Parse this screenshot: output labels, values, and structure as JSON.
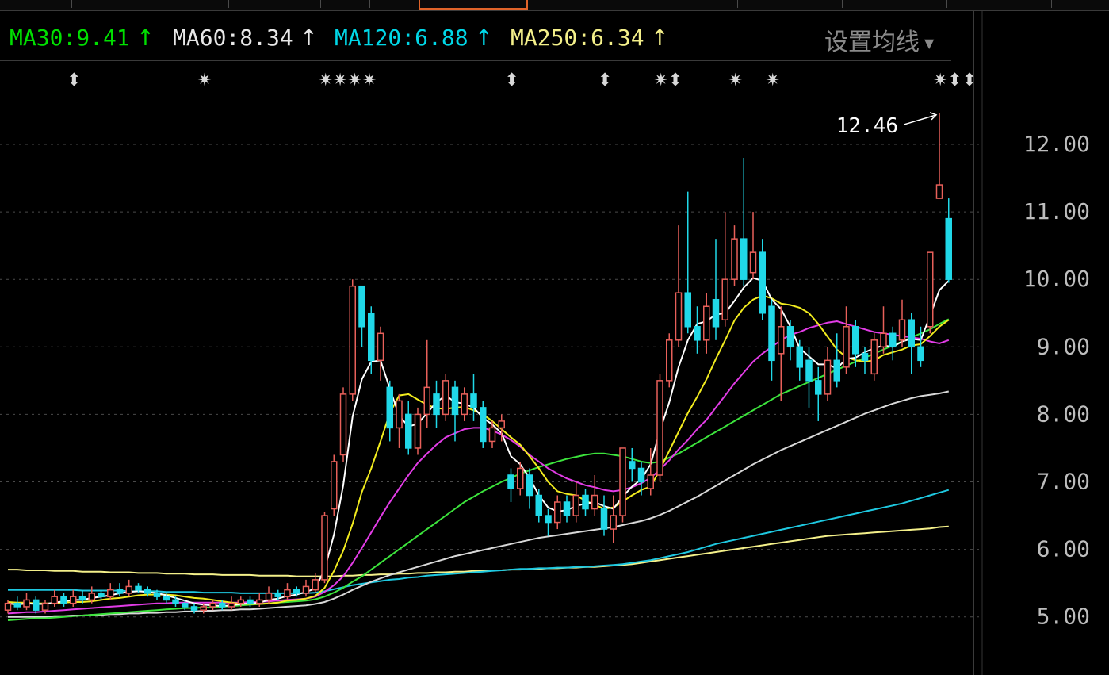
{
  "legend": [
    {
      "label": "MA30:9.41",
      "arrow": "↑",
      "color": "#00e000"
    },
    {
      "label": "MA60:8.34",
      "arrow": "↑",
      "color": "#e8e8e8"
    },
    {
      "label": "MA120:6.88",
      "arrow": "↑",
      "color": "#00d8e8"
    },
    {
      "label": "MA250:6.34",
      "arrow": "↑",
      "color": "#f4f08a"
    }
  ],
  "settings_label": "设置均线",
  "event_markers": [
    {
      "i": 7,
      "glyph": "⬍"
    },
    {
      "i": 21,
      "glyph": "✷"
    },
    {
      "i": 34,
      "glyph": "✷✷✷✷"
    },
    {
      "i": 54,
      "glyph": "⬍"
    },
    {
      "i": 64,
      "glyph": "⬍"
    },
    {
      "i": 70,
      "glyph": "✷⬍"
    },
    {
      "i": 78,
      "glyph": "✷"
    },
    {
      "i": 82,
      "glyph": "✷"
    },
    {
      "i": 100,
      "glyph": "✷⬍⬍"
    }
  ],
  "chart_data": {
    "type": "candlestick",
    "ylim": [
      4.5,
      13.0
    ],
    "yticks": [
      "12.00",
      "11.00",
      "10.00",
      "9.00",
      "8.00",
      "7.00",
      "6.00",
      "5.00"
    ],
    "max_label": "12.46",
    "up_color": "#e8605a",
    "down_color": "#20d8e8",
    "candles": [
      [
        5.1,
        5.2,
        5.25,
        5.05
      ],
      [
        5.2,
        5.15,
        5.3,
        5.1
      ],
      [
        5.15,
        5.25,
        5.35,
        5.1
      ],
      [
        5.25,
        5.1,
        5.3,
        5.05
      ],
      [
        5.1,
        5.2,
        5.25,
        5.05
      ],
      [
        5.2,
        5.3,
        5.4,
        5.15
      ],
      [
        5.3,
        5.2,
        5.35,
        5.15
      ],
      [
        5.2,
        5.3,
        5.4,
        5.15
      ],
      [
        5.3,
        5.25,
        5.4,
        5.2
      ],
      [
        5.25,
        5.35,
        5.45,
        5.2
      ],
      [
        5.35,
        5.3,
        5.4,
        5.25
      ],
      [
        5.3,
        5.4,
        5.5,
        5.25
      ],
      [
        5.4,
        5.35,
        5.5,
        5.3
      ],
      [
        5.35,
        5.45,
        5.55,
        5.3
      ],
      [
        5.45,
        5.4,
        5.5,
        5.35
      ],
      [
        5.4,
        5.35,
        5.45,
        5.3
      ],
      [
        5.35,
        5.3,
        5.4,
        5.25
      ],
      [
        5.3,
        5.25,
        5.35,
        5.2
      ],
      [
        5.25,
        5.2,
        5.3,
        5.15
      ],
      [
        5.2,
        5.15,
        5.25,
        5.1
      ],
      [
        5.15,
        5.1,
        5.2,
        5.05
      ],
      [
        5.1,
        5.15,
        5.2,
        5.05
      ],
      [
        5.15,
        5.2,
        5.25,
        5.1
      ],
      [
        5.2,
        5.15,
        5.25,
        5.1
      ],
      [
        5.15,
        5.2,
        5.3,
        5.1
      ],
      [
        5.2,
        5.25,
        5.3,
        5.15
      ],
      [
        5.25,
        5.2,
        5.3,
        5.15
      ],
      [
        5.2,
        5.25,
        5.35,
        5.15
      ],
      [
        5.25,
        5.35,
        5.45,
        5.2
      ],
      [
        5.35,
        5.3,
        5.4,
        5.25
      ],
      [
        5.3,
        5.4,
        5.5,
        5.25
      ],
      [
        5.4,
        5.35,
        5.45,
        5.3
      ],
      [
        5.35,
        5.45,
        5.55,
        5.3
      ],
      [
        5.4,
        5.55,
        5.65,
        5.35
      ],
      [
        5.55,
        6.5,
        6.55,
        5.5
      ],
      [
        6.6,
        7.3,
        7.4,
        6.5
      ],
      [
        7.4,
        8.3,
        8.4,
        7.3
      ],
      [
        8.3,
        9.9,
        10.0,
        8.2
      ],
      [
        9.9,
        9.3,
        9.9,
        9.0
      ],
      [
        9.5,
        8.8,
        9.6,
        8.6
      ],
      [
        8.8,
        9.2,
        9.3,
        8.5
      ],
      [
        8.4,
        7.8,
        8.5,
        7.6
      ],
      [
        7.8,
        8.2,
        8.3,
        7.5
      ],
      [
        8.0,
        7.5,
        8.2,
        7.4
      ],
      [
        7.5,
        8.0,
        8.1,
        7.4
      ],
      [
        8.0,
        8.4,
        9.1,
        7.8
      ],
      [
        8.3,
        8.0,
        8.5,
        7.8
      ],
      [
        8.0,
        8.5,
        8.6,
        7.9
      ],
      [
        8.4,
        8.0,
        8.5,
        7.6
      ],
      [
        8.0,
        8.3,
        8.4,
        7.9
      ],
      [
        8.3,
        8.1,
        8.6,
        7.9
      ],
      [
        8.1,
        7.6,
        8.2,
        7.5
      ],
      [
        7.6,
        7.8,
        7.9,
        7.5
      ],
      [
        7.8,
        7.9,
        8.0,
        7.6
      ],
      [
        7.1,
        6.9,
        7.2,
        6.7
      ],
      [
        6.9,
        7.2,
        7.3,
        6.8
      ],
      [
        7.1,
        6.8,
        7.2,
        6.6
      ],
      [
        6.8,
        6.5,
        6.9,
        6.4
      ],
      [
        6.5,
        6.4,
        6.6,
        6.2
      ],
      [
        6.4,
        6.7,
        6.8,
        6.3
      ],
      [
        6.7,
        6.5,
        6.8,
        6.4
      ],
      [
        6.5,
        6.8,
        7.0,
        6.4
      ],
      [
        6.8,
        6.6,
        6.9,
        6.5
      ],
      [
        6.6,
        6.8,
        7.1,
        6.5
      ],
      [
        6.6,
        6.3,
        6.8,
        6.2
      ],
      [
        6.3,
        6.5,
        6.8,
        6.1
      ],
      [
        6.5,
        7.5,
        7.5,
        6.4
      ],
      [
        7.3,
        7.2,
        7.5,
        7.0
      ],
      [
        7.2,
        7.0,
        7.3,
        6.8
      ],
      [
        6.9,
        7.1,
        7.5,
        6.8
      ],
      [
        7.1,
        8.5,
        8.6,
        7.0
      ],
      [
        8.5,
        9.1,
        9.2,
        8.4
      ],
      [
        9.1,
        9.8,
        10.8,
        9.0
      ],
      [
        9.8,
        9.3,
        11.3,
        9.2
      ],
      [
        9.3,
        9.1,
        9.6,
        8.9
      ],
      [
        9.1,
        9.6,
        9.8,
        8.9
      ],
      [
        9.7,
        9.3,
        10.6,
        9.1
      ],
      [
        9.4,
        10.0,
        11.0,
        9.3
      ],
      [
        10.0,
        10.6,
        10.8,
        9.9
      ],
      [
        10.6,
        10.0,
        11.8,
        9.9
      ],
      [
        10.1,
        10.4,
        11.0,
        10.0
      ],
      [
        10.4,
        9.5,
        10.6,
        9.4
      ],
      [
        9.6,
        8.8,
        9.7,
        8.5
      ],
      [
        8.9,
        9.3,
        9.6,
        8.2
      ],
      [
        9.3,
        9.0,
        9.4,
        8.8
      ],
      [
        9.0,
        8.7,
        9.1,
        8.5
      ],
      [
        8.8,
        8.5,
        9.0,
        8.1
      ],
      [
        8.5,
        8.3,
        8.7,
        7.9
      ],
      [
        8.3,
        8.8,
        9.0,
        8.2
      ],
      [
        8.8,
        8.5,
        9.2,
        8.4
      ],
      [
        8.7,
        9.3,
        9.6,
        8.6
      ],
      [
        9.3,
        8.9,
        9.4,
        8.7
      ],
      [
        8.9,
        8.8,
        9.0,
        8.6
      ],
      [
        8.6,
        9.1,
        9.2,
        8.5
      ],
      [
        9.0,
        9.2,
        9.6,
        8.9
      ],
      [
        9.2,
        9.0,
        9.3,
        8.8
      ],
      [
        9.1,
        9.4,
        9.7,
        9.0
      ],
      [
        9.4,
        9.0,
        9.5,
        8.6
      ],
      [
        9.0,
        8.8,
        9.3,
        8.7
      ],
      [
        9.3,
        10.4,
        10.4,
        9.2
      ],
      [
        11.2,
        11.4,
        12.46,
        11.2
      ],
      [
        10.9,
        10.0,
        11.2,
        9.95
      ]
    ],
    "ma5": [
      5.2,
      5.18,
      5.2,
      5.19,
      5.19,
      5.21,
      5.23,
      5.25,
      5.25,
      5.28,
      5.3,
      5.32,
      5.35,
      5.37,
      5.38,
      5.37,
      5.35,
      5.32,
      5.28,
      5.24,
      5.2,
      5.18,
      5.17,
      5.16,
      5.17,
      5.19,
      5.2,
      5.21,
      5.25,
      5.27,
      5.31,
      5.33,
      5.37,
      5.42,
      5.7,
      6.22,
      6.95,
      7.97,
      8.52,
      8.78,
      8.8,
      8.38,
      7.98,
      7.82,
      7.86,
      8.02,
      8.18,
      8.28,
      8.18,
      8.16,
      8.1,
      7.95,
      7.85,
      7.72,
      7.38,
      7.26,
      7.06,
      6.8,
      6.62,
      6.56,
      6.58,
      6.64,
      6.68,
      6.7,
      6.64,
      6.6,
      6.78,
      6.93,
      7.04,
      7.26,
      7.76,
      8.18,
      8.7,
      9.1,
      9.34,
      9.38,
      9.48,
      9.5,
      9.68,
      9.88,
      10.02,
      9.98,
      9.7,
      9.56,
      9.3,
      8.98,
      8.86,
      8.74,
      8.74,
      8.68,
      8.82,
      8.84,
      8.92,
      8.98,
      9.02,
      9.0,
      9.08,
      9.12,
      9.1,
      9.46,
      9.84,
      9.98
    ],
    "ma10": [
      5.22,
      5.21,
      5.21,
      5.2,
      5.2,
      5.2,
      5.21,
      5.22,
      5.22,
      5.23,
      5.25,
      5.27,
      5.28,
      5.3,
      5.32,
      5.33,
      5.33,
      5.33,
      5.32,
      5.3,
      5.28,
      5.27,
      5.25,
      5.23,
      5.21,
      5.19,
      5.19,
      5.19,
      5.2,
      5.21,
      5.24,
      5.25,
      5.27,
      5.31,
      5.43,
      5.68,
      5.98,
      6.38,
      6.85,
      7.2,
      7.6,
      8.02,
      8.28,
      8.3,
      8.22,
      8.14,
      8.09,
      8.08,
      8.1,
      8.11,
      8.06,
      8.0,
      7.9,
      7.78,
      7.66,
      7.55,
      7.38,
      7.2,
      7.0,
      6.86,
      6.82,
      6.8,
      6.72,
      6.66,
      6.6,
      6.62,
      6.71,
      6.8,
      6.88,
      6.93,
      7.18,
      7.46,
      7.74,
      8.02,
      8.26,
      8.52,
      8.82,
      9.1,
      9.39,
      9.58,
      9.7,
      9.76,
      9.72,
      9.64,
      9.62,
      9.58,
      9.5,
      9.34,
      9.15,
      8.96,
      8.85,
      8.8,
      8.78,
      8.8,
      8.88,
      8.92,
      8.96,
      9.02,
      9.04,
      9.16,
      9.3,
      9.4
    ],
    "ma20": [
      5.05,
      5.06,
      5.07,
      5.07,
      5.08,
      5.09,
      5.1,
      5.11,
      5.12,
      5.13,
      5.14,
      5.15,
      5.16,
      5.17,
      5.18,
      5.19,
      5.2,
      5.2,
      5.21,
      5.21,
      5.21,
      5.21,
      5.21,
      5.21,
      5.21,
      5.21,
      5.22,
      5.22,
      5.23,
      5.24,
      5.25,
      5.26,
      5.27,
      5.3,
      5.37,
      5.47,
      5.6,
      5.8,
      6.02,
      6.25,
      6.48,
      6.7,
      6.9,
      7.1,
      7.28,
      7.42,
      7.55,
      7.66,
      7.72,
      7.78,
      7.8,
      7.8,
      7.76,
      7.7,
      7.62,
      7.52,
      7.4,
      7.3,
      7.2,
      7.12,
      7.05,
      7.0,
      6.95,
      6.92,
      6.88,
      6.86,
      6.88,
      6.92,
      6.98,
      7.06,
      7.18,
      7.32,
      7.48,
      7.62,
      7.78,
      7.92,
      8.1,
      8.28,
      8.46,
      8.62,
      8.78,
      8.9,
      9.0,
      9.1,
      9.18,
      9.22,
      9.28,
      9.32,
      9.36,
      9.38,
      9.34,
      9.3,
      9.26,
      9.22,
      9.2,
      9.18,
      9.16,
      9.14,
      9.12,
      9.08,
      9.05,
      9.1
    ],
    "ma30": [
      4.95,
      4.96,
      4.97,
      4.98,
      4.98,
      4.99,
      5.0,
      5.01,
      5.02,
      5.03,
      5.04,
      5.05,
      5.06,
      5.07,
      5.08,
      5.09,
      5.1,
      5.11,
      5.12,
      5.13,
      5.13,
      5.14,
      5.14,
      5.15,
      5.16,
      5.17,
      5.18,
      5.19,
      5.2,
      5.21,
      5.22,
      5.23,
      5.24,
      5.26,
      5.3,
      5.36,
      5.43,
      5.52,
      5.6,
      5.7,
      5.8,
      5.9,
      6.0,
      6.1,
      6.2,
      6.3,
      6.4,
      6.5,
      6.6,
      6.7,
      6.78,
      6.86,
      6.93,
      7.0,
      7.06,
      7.12,
      7.17,
      7.22,
      7.26,
      7.3,
      7.34,
      7.37,
      7.4,
      7.42,
      7.42,
      7.4,
      7.38,
      7.34,
      7.3,
      7.28,
      7.3,
      7.36,
      7.42,
      7.5,
      7.58,
      7.66,
      7.74,
      7.82,
      7.9,
      7.98,
      8.06,
      8.14,
      8.22,
      8.3,
      8.36,
      8.42,
      8.48,
      8.54,
      8.6,
      8.66,
      8.72,
      8.78,
      8.84,
      8.9,
      8.96,
      9.02,
      9.08,
      9.14,
      9.2,
      9.26,
      9.34,
      9.41
    ],
    "ma60": [
      5.0,
      5.0,
      5.0,
      5.0,
      5.0,
      5.01,
      5.01,
      5.02,
      5.02,
      5.03,
      5.03,
      5.04,
      5.04,
      5.05,
      5.05,
      5.06,
      5.06,
      5.07,
      5.07,
      5.08,
      5.08,
      5.09,
      5.09,
      5.1,
      5.1,
      5.11,
      5.11,
      5.12,
      5.13,
      5.14,
      5.15,
      5.16,
      5.17,
      5.19,
      5.22,
      5.27,
      5.33,
      5.4,
      5.46,
      5.52,
      5.57,
      5.62,
      5.66,
      5.7,
      5.74,
      5.78,
      5.82,
      5.86,
      5.9,
      5.93,
      5.96,
      5.99,
      6.02,
      6.05,
      6.08,
      6.11,
      6.14,
      6.17,
      6.19,
      6.21,
      6.23,
      6.25,
      6.27,
      6.29,
      6.31,
      6.33,
      6.36,
      6.39,
      6.42,
      6.46,
      6.51,
      6.57,
      6.64,
      6.71,
      6.78,
      6.86,
      6.94,
      7.02,
      7.1,
      7.18,
      7.26,
      7.33,
      7.4,
      7.47,
      7.53,
      7.59,
      7.65,
      7.71,
      7.77,
      7.83,
      7.89,
      7.95,
      8.01,
      8.06,
      8.11,
      8.16,
      8.2,
      8.24,
      8.27,
      8.29,
      8.31,
      8.34
    ],
    "ma120": [
      5.4,
      5.4,
      5.4,
      5.4,
      5.4,
      5.4,
      5.4,
      5.4,
      5.39,
      5.39,
      5.39,
      5.39,
      5.39,
      5.38,
      5.38,
      5.38,
      5.38,
      5.37,
      5.37,
      5.37,
      5.37,
      5.36,
      5.36,
      5.36,
      5.36,
      5.35,
      5.35,
      5.35,
      5.35,
      5.35,
      5.35,
      5.35,
      5.35,
      5.36,
      5.38,
      5.41,
      5.44,
      5.47,
      5.49,
      5.51,
      5.53,
      5.55,
      5.56,
      5.58,
      5.59,
      5.61,
      5.62,
      5.63,
      5.64,
      5.65,
      5.66,
      5.67,
      5.68,
      5.69,
      5.7,
      5.71,
      5.71,
      5.72,
      5.72,
      5.73,
      5.73,
      5.74,
      5.74,
      5.75,
      5.76,
      5.77,
      5.78,
      5.8,
      5.82,
      5.84,
      5.87,
      5.9,
      5.93,
      5.96,
      6.0,
      6.04,
      6.08,
      6.11,
      6.14,
      6.17,
      6.2,
      6.23,
      6.26,
      6.29,
      6.32,
      6.35,
      6.38,
      6.41,
      6.44,
      6.47,
      6.5,
      6.53,
      6.56,
      6.59,
      6.62,
      6.65,
      6.68,
      6.72,
      6.76,
      6.8,
      6.84,
      6.88
    ],
    "ma250": [
      5.7,
      5.7,
      5.69,
      5.69,
      5.69,
      5.68,
      5.68,
      5.68,
      5.67,
      5.67,
      5.67,
      5.66,
      5.66,
      5.66,
      5.65,
      5.65,
      5.65,
      5.64,
      5.64,
      5.64,
      5.63,
      5.63,
      5.63,
      5.62,
      5.62,
      5.62,
      5.62,
      5.61,
      5.61,
      5.61,
      5.61,
      5.6,
      5.6,
      5.6,
      5.6,
      5.6,
      5.61,
      5.61,
      5.62,
      5.62,
      5.63,
      5.63,
      5.64,
      5.64,
      5.65,
      5.65,
      5.66,
      5.66,
      5.67,
      5.67,
      5.68,
      5.68,
      5.69,
      5.69,
      5.7,
      5.7,
      5.71,
      5.71,
      5.72,
      5.72,
      5.73,
      5.73,
      5.74,
      5.74,
      5.75,
      5.76,
      5.77,
      5.78,
      5.8,
      5.82,
      5.84,
      5.86,
      5.88,
      5.9,
      5.92,
      5.94,
      5.96,
      5.98,
      6.0,
      6.02,
      6.04,
      6.06,
      6.08,
      6.1,
      6.12,
      6.14,
      6.16,
      6.18,
      6.2,
      6.21,
      6.22,
      6.23,
      6.24,
      6.25,
      6.26,
      6.27,
      6.28,
      6.29,
      6.3,
      6.31,
      6.33,
      6.34
    ],
    "ma_colors": {
      "ma5": "#ffffff",
      "ma10": "#f2ec1e",
      "ma20": "#e23ce6",
      "ma30": "#3ce33c",
      "ma60": "#d8d8d8",
      "ma120": "#1ec8e0",
      "ma250": "#f4f08a"
    }
  }
}
